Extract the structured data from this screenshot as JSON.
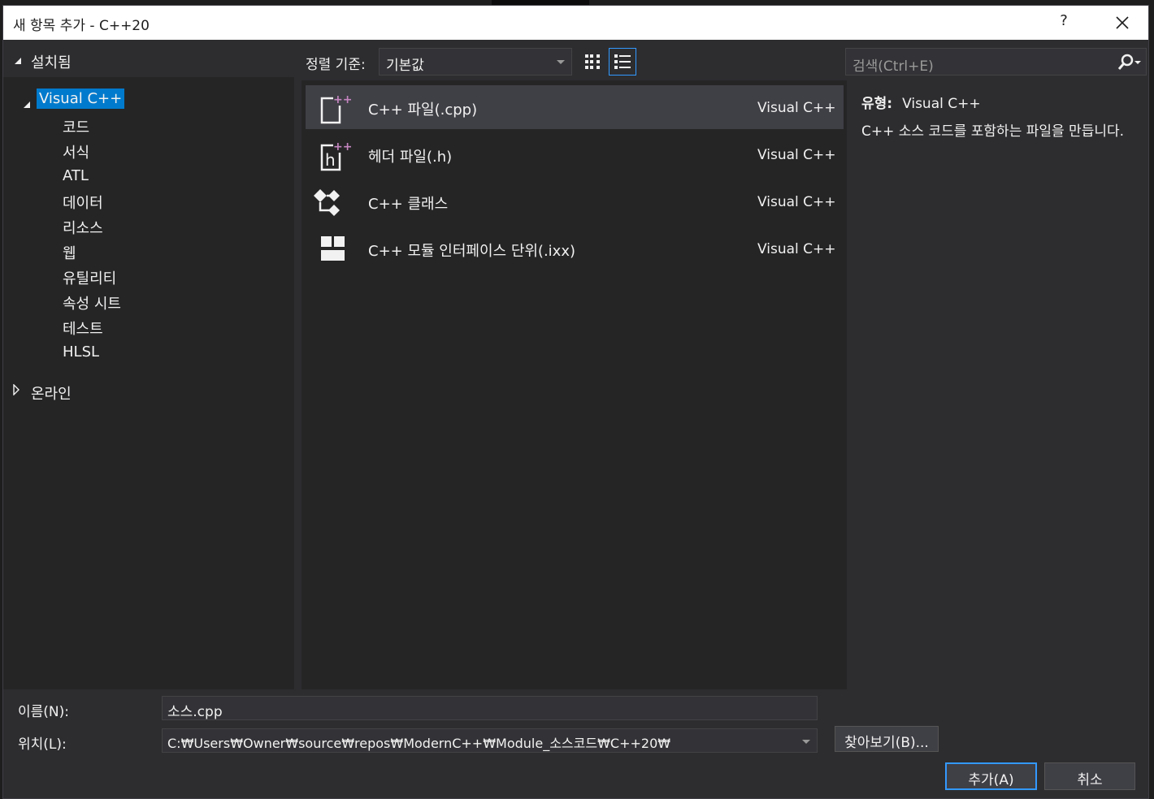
{
  "dialog": {
    "title": "새 항목 추가 - C++20",
    "help_label": "?",
    "close_icon": "close-icon"
  },
  "tree": {
    "installed_label": "설치됨",
    "visual_cpp_label": "Visual C++",
    "children": [
      "코드",
      "서식",
      "ATL",
      "데이터",
      "리소스",
      "웹",
      "유틸리티",
      "속성 시트",
      "테스트",
      "HLSL"
    ],
    "online_label": "온라인"
  },
  "sortbar": {
    "label": "정렬 기준:",
    "selected": "기본값"
  },
  "templates": [
    {
      "name": "C++ 파일(.cpp)",
      "lang": "Visual C++",
      "icon": "cpp-file-icon"
    },
    {
      "name": "헤더 파일(.h)",
      "lang": "Visual C++",
      "icon": "header-file-icon"
    },
    {
      "name": "C++ 클래스",
      "lang": "Visual C++",
      "icon": "class-icon"
    },
    {
      "name": "C++ 모듈 인터페이스 단위(.ixx)",
      "lang": "Visual C++",
      "icon": "module-icon"
    }
  ],
  "search": {
    "placeholder": "검색(Ctrl+E)"
  },
  "info": {
    "type_label": "유형:",
    "type_value": "Visual C++",
    "description": "C++ 소스 코드를 포함하는 파일을 만듭니다."
  },
  "form": {
    "name_label": "이름(N):",
    "name_value": "소스.cpp",
    "location_label": "위치(L):",
    "location_value": "C:₩Users₩Owner₩source₩repos₩ModernC++₩Module_소스코드₩C++20₩",
    "browse_label": "찾아보기(B)...",
    "add_label": "추가(A)",
    "cancel_label": "취소"
  },
  "colors": {
    "accent": "#007acc",
    "cpp_badge": "#c586c0",
    "dialog_bg": "#2d2d30",
    "pane_bg": "#252526"
  }
}
